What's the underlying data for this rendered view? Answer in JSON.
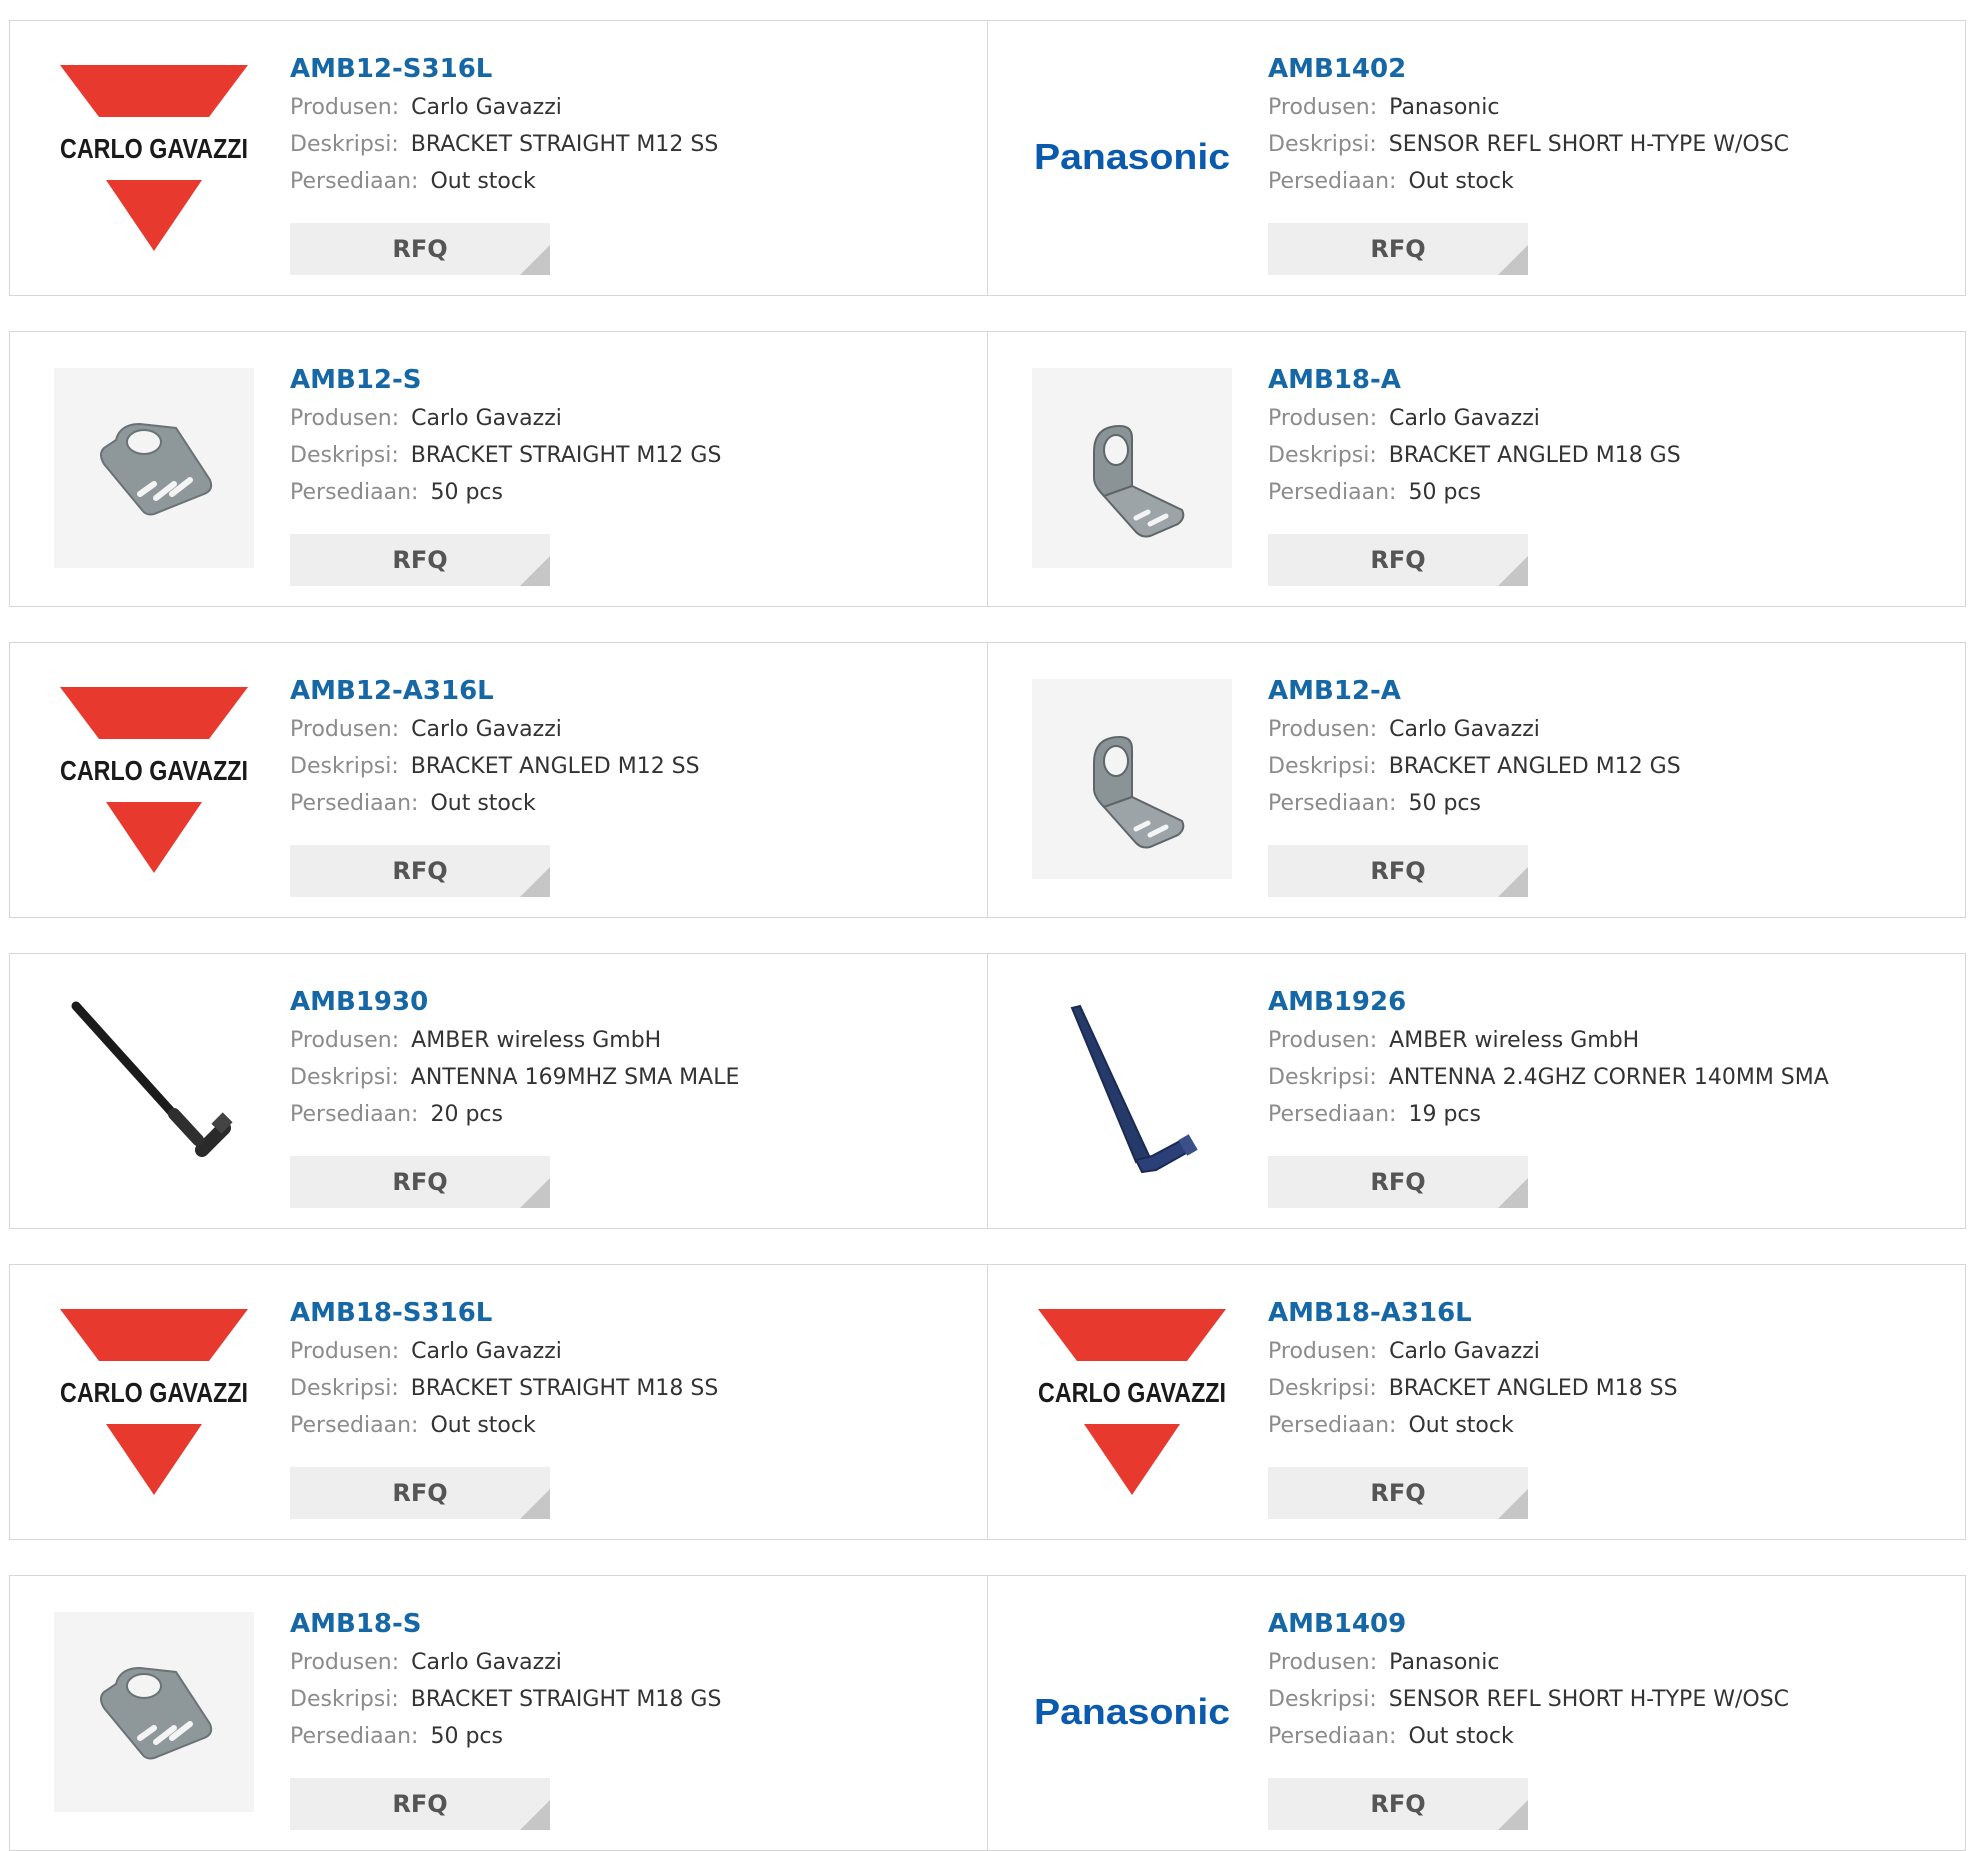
{
  "labels": {
    "manufacturer": "Produsen:",
    "description": "Deskripsi:",
    "stock": "Persediaan:",
    "rfq": "RFQ"
  },
  "colors": {
    "part_link": "#1667a6",
    "carlo_gavazzi_red": "#e8392e",
    "panasonic_blue": "#0a5bad",
    "rfq_bg": "#eeeeee"
  },
  "logo_text": {
    "carlo": "CARLO GAVAZZI",
    "panasonic": "Panasonic"
  },
  "products": [
    {
      "part": "AMB12-S316L",
      "manufacturer": "Carlo Gavazzi",
      "description": "BRACKET STRAIGHT M12 SS",
      "stock": "Out stock",
      "image": "carlo-gavazzi-logo"
    },
    {
      "part": "AMB1402",
      "manufacturer": "Panasonic",
      "description": "SENSOR REFL SHORT H-TYPE W/OSC",
      "stock": "Out stock",
      "image": "panasonic-logo"
    },
    {
      "part": "AMB12-S",
      "manufacturer": "Carlo Gavazzi",
      "description": "BRACKET STRAIGHT M12 GS",
      "stock": "50 pcs",
      "image": "bracket-straight-icon"
    },
    {
      "part": "AMB18-A",
      "manufacturer": "Carlo Gavazzi",
      "description": "BRACKET ANGLED M18 GS",
      "stock": "50 pcs",
      "image": "bracket-angled-icon"
    },
    {
      "part": "AMB12-A316L",
      "manufacturer": "Carlo Gavazzi",
      "description": "BRACKET ANGLED M12 SS",
      "stock": "Out stock",
      "image": "carlo-gavazzi-logo"
    },
    {
      "part": "AMB12-A",
      "manufacturer": "Carlo Gavazzi",
      "description": "BRACKET ANGLED M12 GS",
      "stock": "50 pcs",
      "image": "bracket-angled-icon"
    },
    {
      "part": "AMB1930",
      "manufacturer": "AMBER wireless GmbH",
      "description": "ANTENNA 169MHZ SMA MALE",
      "stock": "20 pcs",
      "image": "antenna-black-icon"
    },
    {
      "part": "AMB1926",
      "manufacturer": "AMBER wireless GmbH",
      "description": "ANTENNA 2.4GHZ CORNER 140MM SMA",
      "stock": "19 pcs",
      "image": "antenna-blue-icon"
    },
    {
      "part": "AMB18-S316L",
      "manufacturer": "Carlo Gavazzi",
      "description": "BRACKET STRAIGHT M18 SS",
      "stock": "Out stock",
      "image": "carlo-gavazzi-logo"
    },
    {
      "part": "AMB18-A316L",
      "manufacturer": "Carlo Gavazzi",
      "description": "BRACKET ANGLED M18 SS",
      "stock": "Out stock",
      "image": "carlo-gavazzi-logo"
    },
    {
      "part": "AMB18-S",
      "manufacturer": "Carlo Gavazzi",
      "description": "BRACKET STRAIGHT M18 GS",
      "stock": "50 pcs",
      "image": "bracket-straight-icon"
    },
    {
      "part": "AMB1409",
      "manufacturer": "Panasonic",
      "description": "SENSOR REFL SHORT H-TYPE W/OSC",
      "stock": "Out stock",
      "image": "panasonic-logo"
    }
  ]
}
